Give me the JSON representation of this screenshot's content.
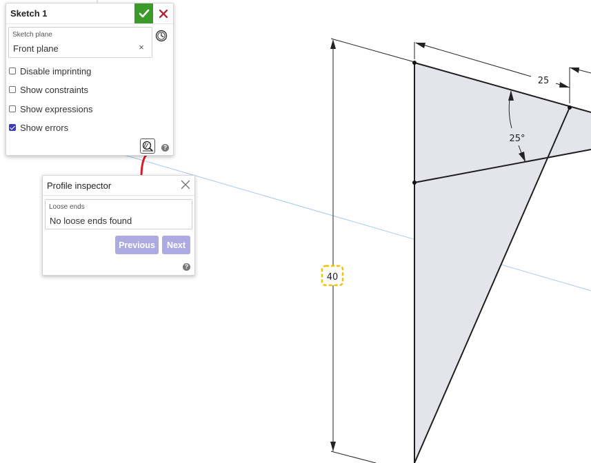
{
  "sketch_panel": {
    "title": "Sketch 1",
    "sketch_plane_label": "Sketch plane",
    "sketch_plane_value": "Front plane",
    "clear_symbol": "×",
    "options": [
      {
        "label": "Disable imprinting",
        "checked": false
      },
      {
        "label": "Show constraints",
        "checked": false
      },
      {
        "label": "Show expressions",
        "checked": false
      },
      {
        "label": "Show errors",
        "checked": true
      }
    ],
    "help_symbol": "?"
  },
  "profile_inspector": {
    "title": "Profile inspector",
    "loose_ends_label": "Loose ends",
    "loose_ends_value": "No loose ends found",
    "previous_label": "Previous",
    "next_label": "Next",
    "help_symbol": "?"
  },
  "dimensions": {
    "top_length": "25",
    "angle": "25°",
    "height": "40"
  },
  "colors": {
    "accept_green": "#3c9a2a",
    "cancel_red": "#b1263b",
    "checkbox_blue": "#3a3fb8",
    "button_lavender": "#acaae0",
    "highlight_yellow": "#f2c400",
    "profile_fill": "#e4e5ea",
    "plane_line": "#a9c8ee"
  },
  "icons": [
    "check-icon",
    "close-icon",
    "history-icon",
    "profile-inspector-icon",
    "help-icon"
  ]
}
